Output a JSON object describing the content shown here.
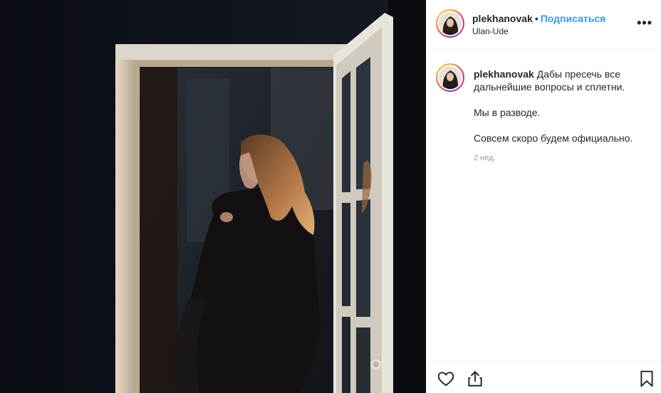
{
  "header": {
    "username": "plekhanovak",
    "separator": "•",
    "follow_label": "Подписаться",
    "location": "Ulan-Ude",
    "more_icon": "ellipsis-icon",
    "more_label": "•••"
  },
  "caption": {
    "username": "plekhanovak",
    "line1": "Дабы пресечь все дальнейшие вопросы и сплетни.",
    "line2": "Мы в разводе.",
    "line3": "Совсем скоро будем официально.",
    "timestamp": "2 нед."
  },
  "actions": {
    "like_icon": "heart-icon",
    "share_icon": "share-icon",
    "save_icon": "bookmark-icon"
  },
  "colors": {
    "follow": "#3897f0",
    "border": "#efefef",
    "muted": "#999999"
  }
}
